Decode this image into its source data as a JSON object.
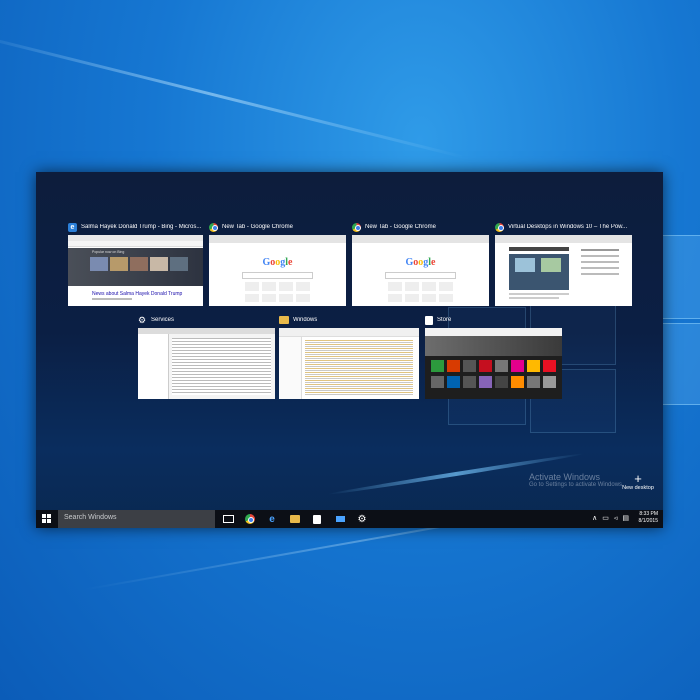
{
  "thumbnails_row1": [
    {
      "title": "Salma Hayek Donald Trump - Bing - Micros...",
      "icon": "edge-icon"
    },
    {
      "title": "New Tab - Google Chrome",
      "icon": "chrome-icon"
    },
    {
      "title": "New Tab - Google Chrome",
      "icon": "chrome-icon"
    },
    {
      "title": "Virtual Desktops in Windows 10 – The Pow...",
      "icon": "chrome-icon"
    }
  ],
  "thumbnails_row2": [
    {
      "title": "Services",
      "icon": "gear-icon"
    },
    {
      "title": "Windows",
      "icon": "folder-icon"
    },
    {
      "title": "Store",
      "icon": "store-bag-icon"
    }
  ],
  "bing_thumb": {
    "news_heading": "News about Salma Hayek Donald Trump",
    "section": "Popular now on Bing"
  },
  "google_logo": "Google",
  "activation": {
    "title": "Activate Windows",
    "subtitle": "Go to Settings to activate Windows."
  },
  "new_desktop": {
    "plus": "+",
    "label": "New desktop"
  },
  "taskbar": {
    "search_placeholder": "Search Windows",
    "time": "8:33 PM",
    "date": "8/1/2015"
  },
  "colors": {
    "desktop_bg": "#1677d2",
    "taskview_bg": "#0b1f44",
    "taskbar_bg": "#0c0f16",
    "accent": "#2b7fd8"
  }
}
